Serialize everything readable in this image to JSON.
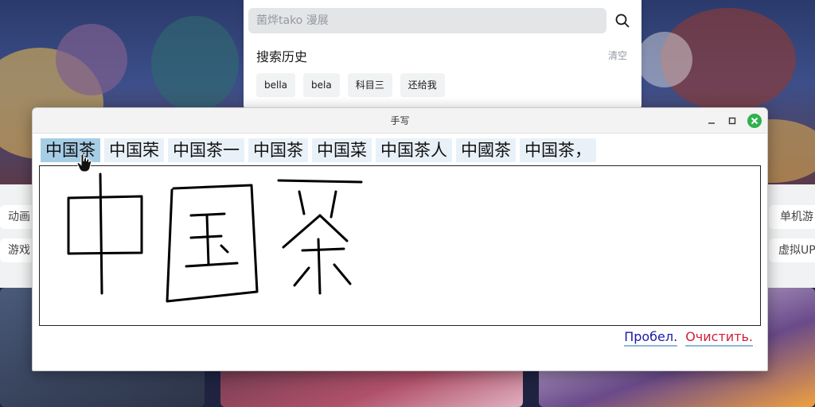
{
  "search": {
    "placeholder": "菌烨tako 漫展",
    "history_title": "搜索历史",
    "clear_label": "清空",
    "history": [
      "bella",
      "bela",
      "科目三",
      "还给我"
    ]
  },
  "page": {
    "left_pills": [
      "动画",
      "游戏"
    ],
    "right_pills": [
      "单机游",
      "虚拟UP"
    ]
  },
  "handwriting": {
    "window_title": "手写",
    "candidates": [
      "中国茶",
      "中国荣",
      "中国茶一",
      "中国茶",
      "中国菜",
      "中国茶人",
      "中國茶",
      "中国茶，"
    ],
    "selected_index": 0,
    "space_label": "Пробел.",
    "clear_label": "Очистить."
  },
  "colors": {
    "close_button": "#2fb24c",
    "candidate_bg": "#e9f1f8",
    "candidate_selected_bg": "#a6cde6",
    "space_link": "#1a1aa6",
    "clear_link": "#d01e3c"
  }
}
